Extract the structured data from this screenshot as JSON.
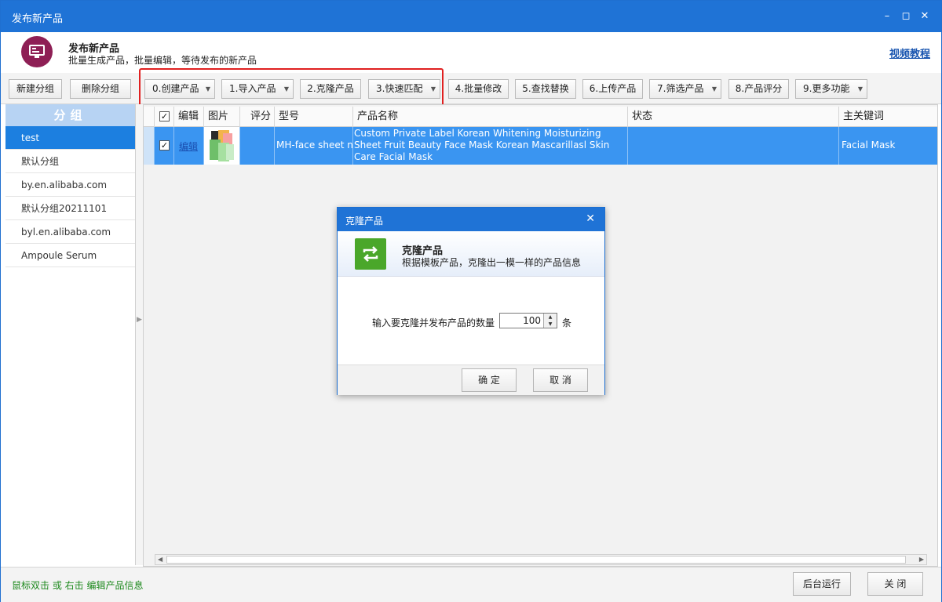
{
  "window": {
    "title": "发布新产品"
  },
  "header": {
    "title": "发布新产品",
    "subtitle": "批量生成产品，批量编辑，等待发布的新产品",
    "video_link": "视频教程"
  },
  "toolbar": {
    "new_group": "新建分组",
    "delete_group": "删除分组",
    "buttons": [
      {
        "label": "0.创建产品",
        "dropdown": true
      },
      {
        "label": "1.导入产品",
        "dropdown": true
      },
      {
        "label": "2.克隆产品",
        "dropdown": false
      },
      {
        "label": "3.快速匹配",
        "dropdown": true
      },
      {
        "label": "4.批量修改",
        "dropdown": false
      },
      {
        "label": "5.查找替换",
        "dropdown": false
      },
      {
        "label": "6.上传产品",
        "dropdown": false
      },
      {
        "label": "7.筛选产品",
        "dropdown": true
      },
      {
        "label": "8.产品评分",
        "dropdown": false
      },
      {
        "label": "9.更多功能",
        "dropdown": true
      }
    ]
  },
  "sidebar": {
    "header": "分组",
    "items": [
      {
        "label": "test",
        "active": true
      },
      {
        "label": "默认分组"
      },
      {
        "label": "by.en.alibaba.com"
      },
      {
        "label": "默认分组20211101"
      },
      {
        "label": "byl.en.alibaba.com"
      },
      {
        "label": "Ampoule Serum"
      }
    ]
  },
  "grid": {
    "columns": [
      "编辑",
      "图片",
      "评分",
      "型号",
      "产品名称",
      "状态",
      "主关键词"
    ],
    "rows": [
      {
        "checked": true,
        "edit": "编辑",
        "score": "",
        "model": "MH-face sheet n",
        "name": "Custom Private Label Korean Whitening Moisturizing Sheet Fruit Beauty Face Mask Korean Mascarillasl Skin Care Facial Mask",
        "status": "",
        "keyword": "Facial Mask"
      }
    ]
  },
  "footer": {
    "hint": "鼠标双击 或 右击 编辑产品信息",
    "background_run": "后台运行",
    "close": "关 闭"
  },
  "dialog": {
    "title": "克隆产品",
    "heading": "克隆产品",
    "description": "根据模板产品，克隆出一模一样的产品信息",
    "label": "输入要克隆并发布产品的数量",
    "quantity": "100",
    "unit": "条",
    "ok": "确 定",
    "cancel": "取 消"
  },
  "colors": {
    "titlebar": "#1f73d6",
    "selected_row": "#3a95f1",
    "highlight": "#e02020",
    "hint_text": "#1f8a1f"
  }
}
